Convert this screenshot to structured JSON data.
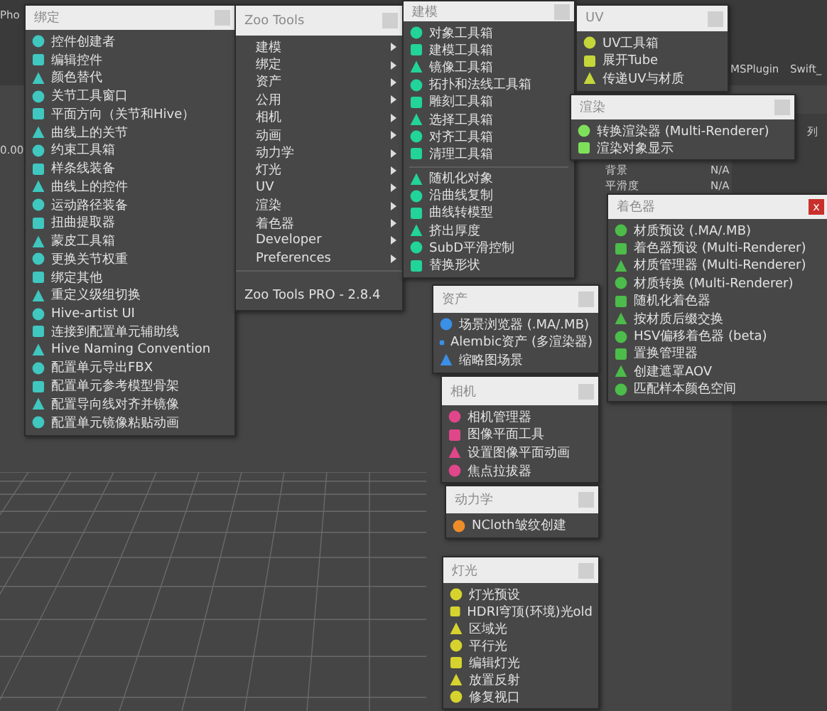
{
  "background_texts": [
    {
      "text": "Pho"
    },
    {
      "text": "0.00"
    },
    {
      "text": "MSPlugin"
    },
    {
      "text": "Swift_"
    },
    {
      "text": "列"
    },
    {
      "text": "背景"
    },
    {
      "text": "N/A"
    },
    {
      "text": "平滑度"
    },
    {
      "text": "N/A"
    }
  ],
  "panels": [
    {
      "title": "绑定",
      "items": [
        {
          "label": "控件创建者"
        },
        {
          "label": "编辑控件"
        },
        {
          "label": "颜色替代"
        },
        {
          "label": "关节工具窗口"
        },
        {
          "label": "平面方向（关节和Hive）"
        },
        {
          "label": "曲线上的关节"
        },
        {
          "label": "约束工具箱"
        },
        {
          "label": "样条线装备"
        },
        {
          "label": "曲线上的控件"
        },
        {
          "label": "运动路径装备"
        },
        {
          "label": "扭曲提取器"
        },
        {
          "label": "蒙皮工具箱"
        },
        {
          "label": "更换关节权重"
        },
        {
          "label": "绑定其他"
        },
        {
          "label": "重定义级组切换"
        },
        {
          "label": "Hive-artist UI"
        },
        {
          "label": "连接到配置单元辅助线"
        },
        {
          "label": "Hive Naming Convention"
        },
        {
          "label": "配置单元导出FBX"
        },
        {
          "label": "配置单元参考模型骨架"
        },
        {
          "label": "配置导向线对齐并镜像"
        },
        {
          "label": "配置单元镜像粘贴动画"
        }
      ]
    },
    {
      "title": "Zoo Tools",
      "footer": "Zoo Tools PRO - 2.8.4",
      "items": [
        {
          "label": "建模",
          "submenu": true
        },
        {
          "label": "绑定",
          "submenu": true
        },
        {
          "label": "资产",
          "submenu": true
        },
        {
          "label": "公用",
          "submenu": true
        },
        {
          "label": "相机",
          "submenu": true
        },
        {
          "label": "动画",
          "submenu": true
        },
        {
          "label": "动力学",
          "submenu": true
        },
        {
          "label": "灯光",
          "submenu": true
        },
        {
          "label": "UV",
          "submenu": true
        },
        {
          "label": "渲染",
          "submenu": true
        },
        {
          "label": "着色器",
          "submenu": true
        },
        {
          "label": "Developer",
          "submenu": true
        },
        {
          "label": "Preferences",
          "submenu": true
        }
      ]
    },
    {
      "title": "建模",
      "items": [
        {
          "label": "对象工具箱"
        },
        {
          "label": "建模工具箱"
        },
        {
          "label": "镜像工具箱"
        },
        {
          "label": "拓扑和法线工具箱"
        },
        {
          "label": "雕刻工具箱"
        },
        {
          "label": "选择工具箱"
        },
        {
          "label": "对齐工具箱"
        },
        {
          "label": "清理工具箱"
        },
        {
          "label": "随机化对象",
          "separator_before": true
        },
        {
          "label": "沿曲线复制"
        },
        {
          "label": "曲线转模型"
        },
        {
          "label": "挤出厚度"
        },
        {
          "label": "SubD平滑控制"
        },
        {
          "label": "替换形状"
        }
      ]
    },
    {
      "title": "UV",
      "items": [
        {
          "label": "UV工具箱"
        },
        {
          "label": "展开Tube"
        },
        {
          "label": "传递UV与材质"
        }
      ]
    },
    {
      "title": "渲染",
      "items": [
        {
          "label": "转换渲染器 (Multi-Renderer)"
        },
        {
          "label": "渲染对象显示"
        }
      ]
    },
    {
      "title": "着色器",
      "close_label": "x",
      "items": [
        {
          "label": "材质预设 (.MA/.MB)"
        },
        {
          "label": "着色器预设 (Multi-Renderer)"
        },
        {
          "label": "材质管理器 (Multi-Renderer)"
        },
        {
          "label": "材质转换 (Multi-Renderer)"
        },
        {
          "label": "随机化着色器"
        },
        {
          "label": "按材质后缀交换"
        },
        {
          "label": "HSV偏移着色器 (beta)"
        },
        {
          "label": "置换管理器"
        },
        {
          "label": "创建遮罩AOV"
        },
        {
          "label": "匹配样本颜色空间"
        }
      ]
    },
    {
      "title": "资产",
      "items": [
        {
          "label": "场景浏览器 (.MA/.MB)"
        },
        {
          "label": "Alembic资产 (多渲染器)"
        },
        {
          "label": "缩略图场景"
        }
      ]
    },
    {
      "title": "相机",
      "items": [
        {
          "label": "相机管理器"
        },
        {
          "label": "图像平面工具"
        },
        {
          "label": "设置图像平面动画"
        },
        {
          "label": "焦点拉拔器"
        }
      ]
    },
    {
      "title": "动力学",
      "items": [
        {
          "label": "NCloth皱纹创建"
        }
      ]
    },
    {
      "title": "灯光",
      "items": [
        {
          "label": "灯光预设"
        },
        {
          "label": "HDRI穹顶(环境)光old"
        },
        {
          "label": "区域光"
        },
        {
          "label": "平行光"
        },
        {
          "label": "编辑灯光"
        },
        {
          "label": "放置反射"
        },
        {
          "label": "修复视口"
        }
      ]
    }
  ]
}
